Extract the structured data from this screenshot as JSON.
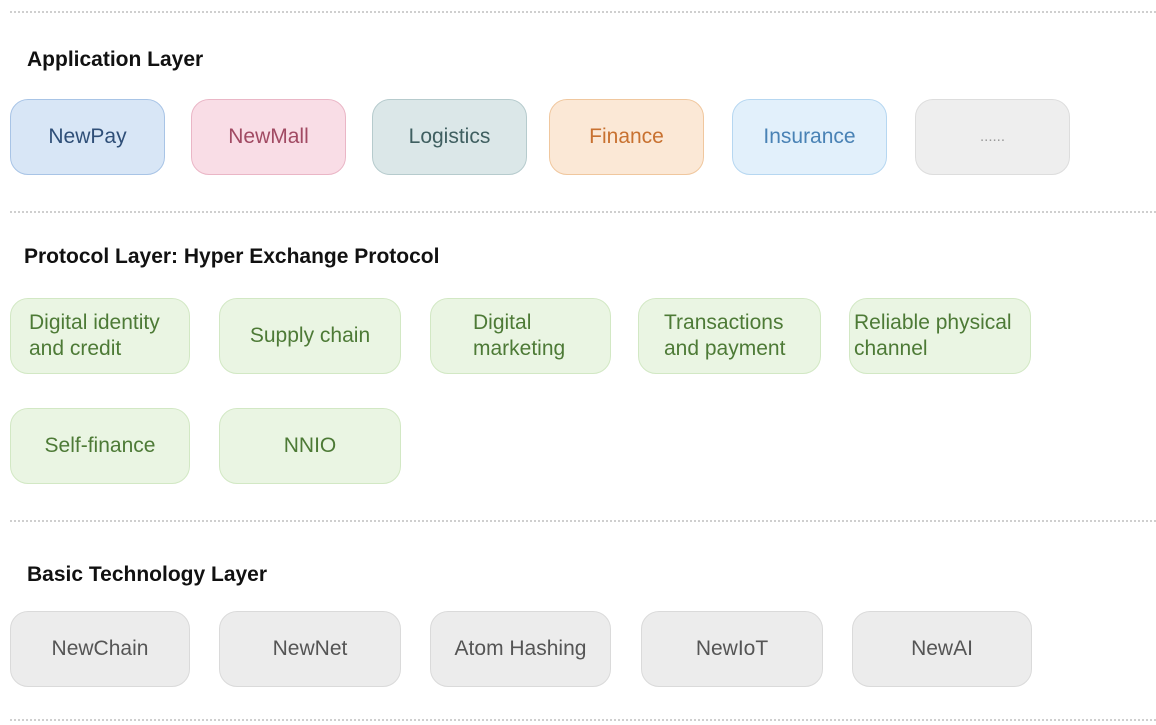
{
  "application_layer": {
    "title": "Application Layer",
    "items": [
      "NewPay",
      "NewMall",
      "Logistics",
      "Finance",
      "Insurance",
      "......"
    ]
  },
  "protocol_layer": {
    "title": "Protocol Layer: Hyper Exchange Protocol",
    "items": [
      [
        "Digital identity",
        "and credit"
      ],
      [
        "Supply chain"
      ],
      [
        "Digital",
        "marketing"
      ],
      [
        "Transactions",
        "and payment"
      ],
      [
        "Reliable physical",
        "channel"
      ],
      [
        "Self-finance"
      ],
      [
        "NNIO"
      ]
    ]
  },
  "technology_layer": {
    "title": "Basic Technology Layer",
    "items": [
      "NewChain",
      "NewNet",
      "Atom Hashing",
      "NewIoT",
      "NewAI"
    ]
  },
  "colors": {
    "newpay": "#d8e6f6",
    "newmall": "#f9dde6",
    "logistics": "#dbe7e8",
    "finance": "#fbe8d6",
    "insurance": "#e2f0fb",
    "more": "#eeeeee",
    "protocol": "#eaf5e3",
    "technology": "#ececec"
  }
}
